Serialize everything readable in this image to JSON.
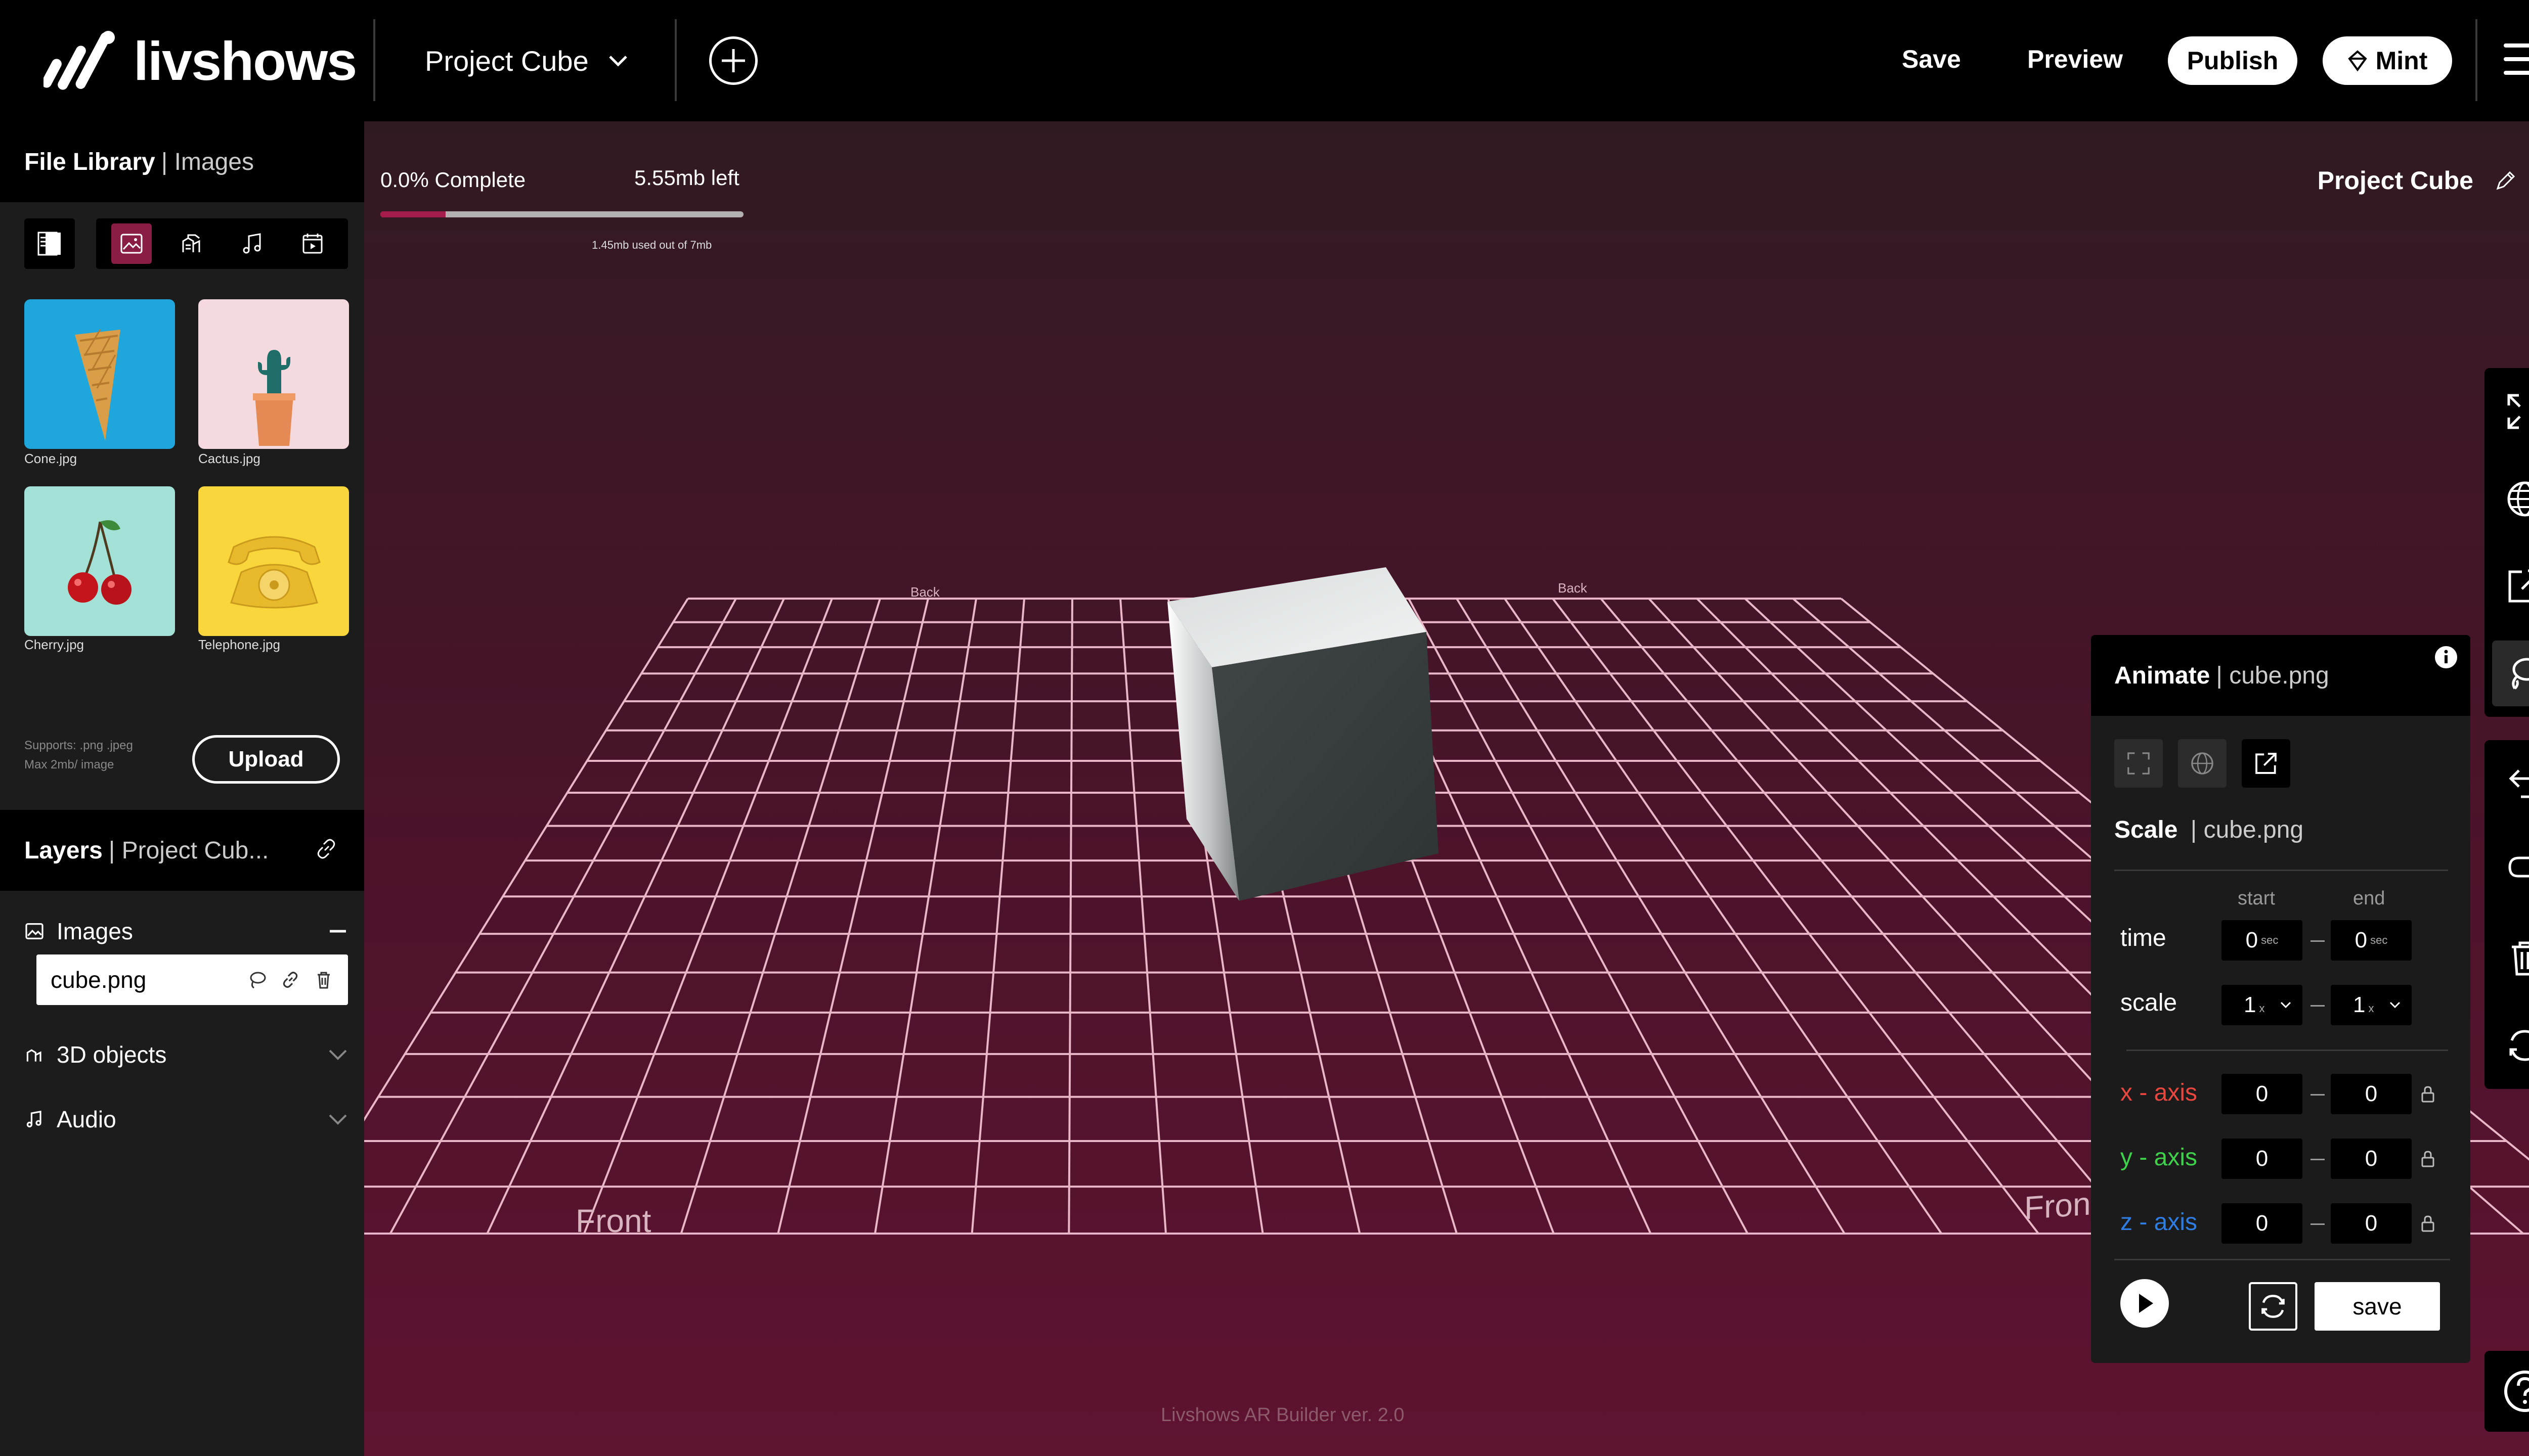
{
  "header": {
    "brand": "livshows",
    "project_name": "Project Cube",
    "save_label": "Save",
    "preview_label": "Preview",
    "publish_label": "Publish",
    "mint_label": "Mint"
  },
  "file_library": {
    "title": "File Library",
    "subtitle": "Images",
    "images": [
      {
        "name": "Cone.jpg",
        "bg": "#1fa7dd"
      },
      {
        "name": "Cactus.jpg",
        "bg": "#f4d9de"
      },
      {
        "name": "Cherry.jpg",
        "bg": "#a3e1d7"
      },
      {
        "name": "Telephone.jpg",
        "bg": "#f9d63b"
      }
    ],
    "supports_line1": "Supports: .png .jpeg",
    "supports_line2": "Max 2mb/ image",
    "upload_label": "Upload"
  },
  "layers": {
    "title": "Layers",
    "subtitle": "Project Cub...",
    "groups": [
      {
        "label": "Images"
      },
      {
        "label": "3D objects"
      },
      {
        "label": "Audio"
      }
    ],
    "images_item": "cube.png"
  },
  "storage": {
    "complete_text": "0.0% Complete",
    "left_text": "5.55mb left",
    "used_text": "1.45mb used out of 7mb",
    "fill_fraction": 0.18
  },
  "canvas": {
    "title": "Project Cube",
    "front_label": "Front",
    "front_label_right": "Fron",
    "back_label": "Back",
    "version": "Livshows AR Builder ver. 2.0"
  },
  "animate": {
    "title": "Animate",
    "subtitle": "cube.png",
    "scale_title": "Scale",
    "scale_subtitle": "cube.png",
    "col_start": "start",
    "col_end": "end",
    "time_label": "time",
    "time_start": "0",
    "time_end": "0",
    "time_unit": "sec",
    "scale_label": "scale",
    "scale_start": "1",
    "scale_end": "1",
    "scale_unit": "x",
    "x_label": "x - axis",
    "x_start": "0",
    "x_end": "0",
    "y_label": "y - axis",
    "y_start": "0",
    "y_end": "0",
    "z_label": "z - axis",
    "z_start": "0",
    "z_end": "0",
    "save_label": "save",
    "colors": {
      "x": "#e8473f",
      "y": "#3fd04c",
      "z": "#2f7de1"
    }
  },
  "icons": [
    "menu-icon",
    "plus-circle-icon",
    "chevron-down-icon",
    "diamond-icon",
    "fullscreen-icon",
    "globe-icon",
    "external-link-icon",
    "lasso-icon",
    "undo-icon",
    "redo-icon",
    "trash-icon",
    "rotate-icon",
    "help-icon",
    "pencil-icon",
    "lock-icon",
    "play-icon",
    "loop-icon",
    "link-icon",
    "info-icon"
  ]
}
